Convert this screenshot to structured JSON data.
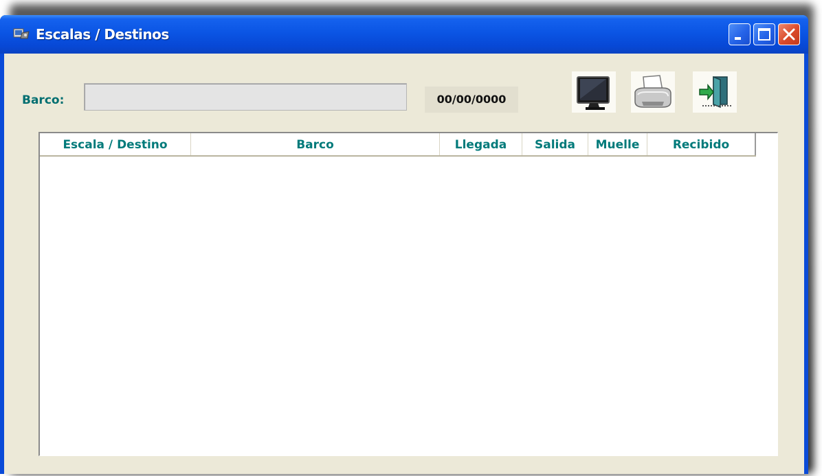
{
  "window": {
    "title": "Escalas / Destinos",
    "accent": "#0a4bd8",
    "buttons": {
      "minimize": "minimize-icon",
      "maximize": "maximize-icon",
      "close": "close-icon"
    }
  },
  "form": {
    "barco_label": "Barco:",
    "barco_value": "",
    "date": "00/00/0000"
  },
  "toolbar": {
    "icons": [
      "monitor-icon",
      "printer-icon",
      "exit-door-icon"
    ]
  },
  "table": {
    "columns": [
      "Escala / Destino",
      "Barco",
      "Llegada",
      "Salida",
      "Muelle",
      "Recibido"
    ],
    "rows": []
  },
  "colors": {
    "label_teal": "#006e70",
    "client_bg": "#ece9d8"
  }
}
